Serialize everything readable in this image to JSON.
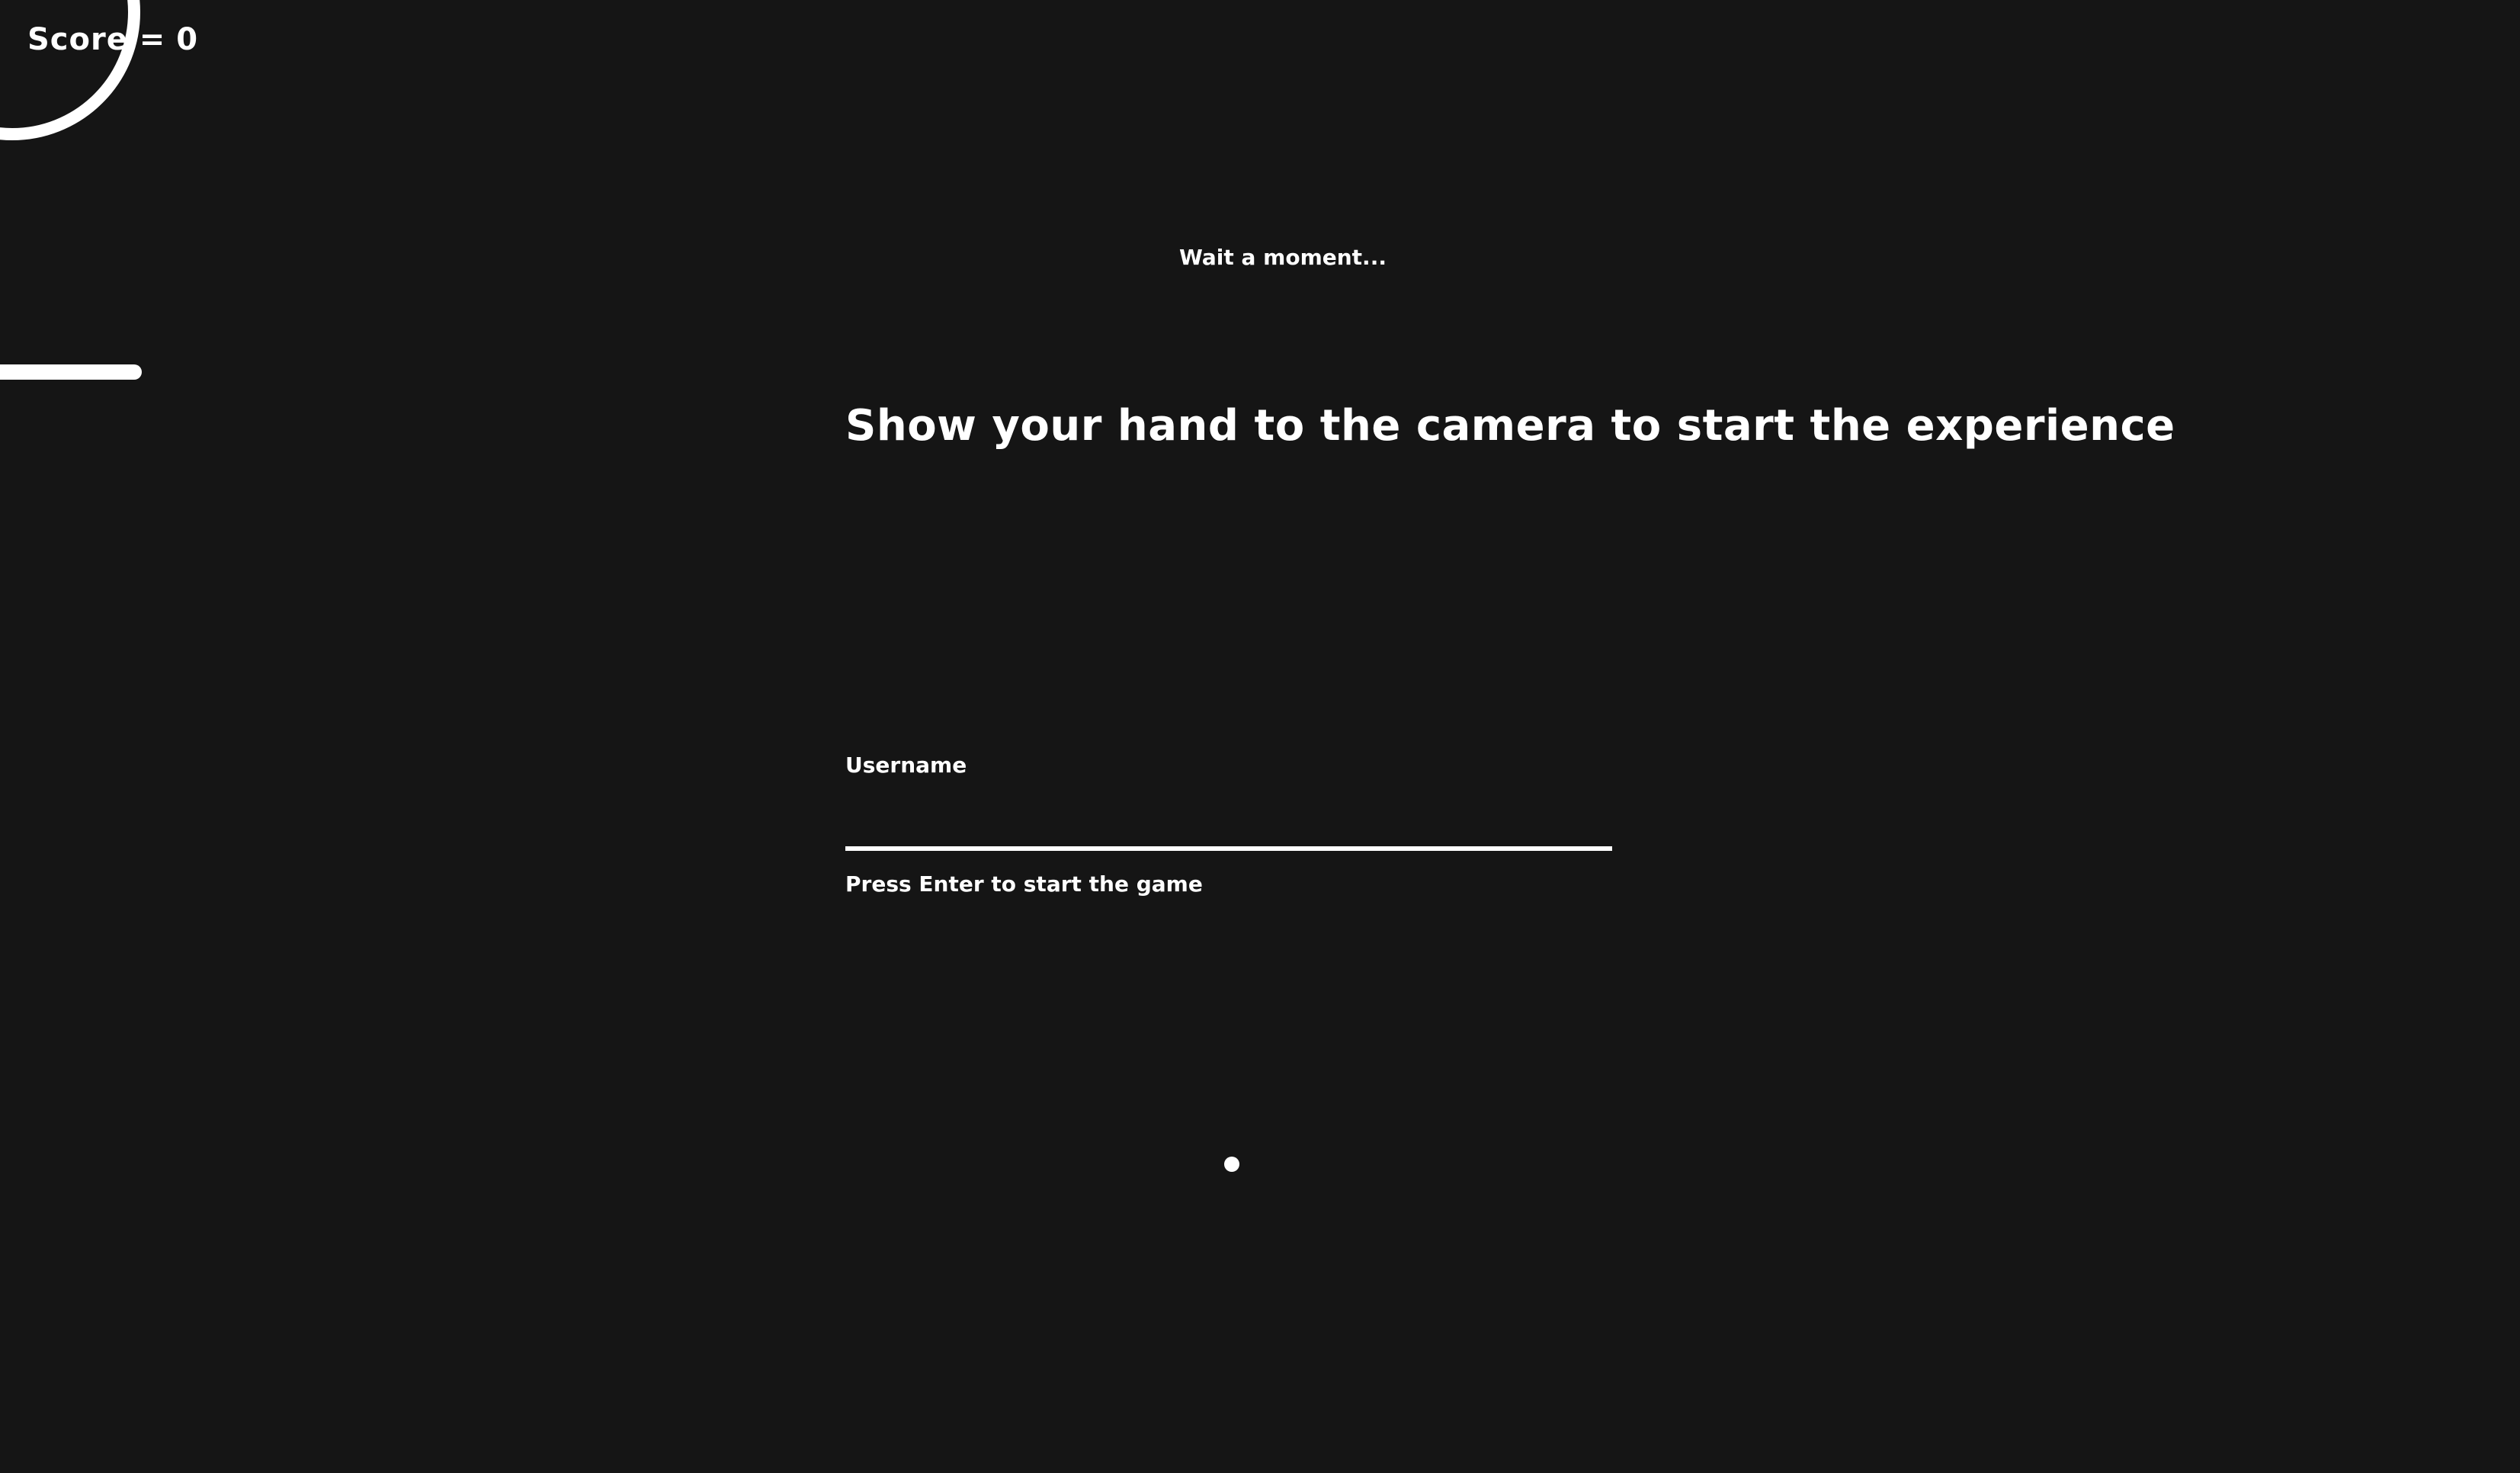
{
  "score": {
    "prefix": "Score =",
    "value": "0"
  },
  "status": {
    "message": "Wait a moment..."
  },
  "instructions": {
    "headline": "Show your hand to the camera to start the experience"
  },
  "form": {
    "username_label": "Username",
    "username_value": "",
    "hint": "Press Enter to start the game"
  }
}
